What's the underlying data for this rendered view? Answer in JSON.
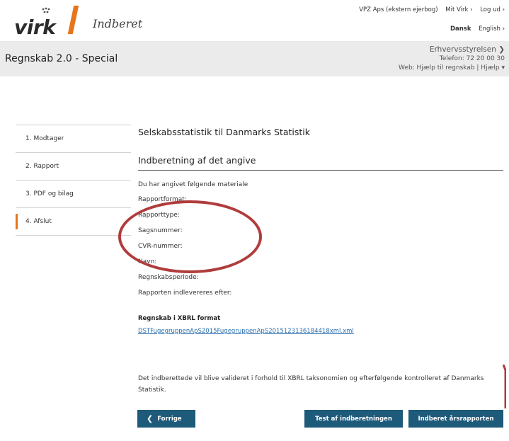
{
  "header": {
    "logo_text": "virk",
    "product": "Indberet",
    "company": "VPZ Aps (ekstern ejerbog)",
    "my_virk": "Mit Virk ›",
    "logout": "Log ud ›",
    "lang_active": "Dansk",
    "lang_other": "English ›"
  },
  "subheader": {
    "title": "Regnskab 2.0 - Special",
    "org": "Erhvervsstyrelsen ❯",
    "phone": "Telefon: 72 20 00 30",
    "web": "Web: Hjælp til regnskab | Hjælp ▾"
  },
  "sidebar": {
    "items": [
      {
        "label": "1. Modtager"
      },
      {
        "label": "2. Rapport"
      },
      {
        "label": "3. PDF og bilag"
      },
      {
        "label": "4. Afslut"
      }
    ]
  },
  "main": {
    "title": "Selskabsstatistik til Danmarks Statistik",
    "section_title": "Indberetning af det angive",
    "intro": "Du har angivet følgende materiale",
    "fields": [
      "Rapportformat:",
      "Rapporttype:",
      "Sagsnummer:",
      "CVR-nummer:",
      "Navn:",
      "Regnskabsperiode:",
      "Rapporten indlevereres efter:"
    ],
    "xbrl_title": "Regnskab i XBRL format",
    "xbrl_file": "DSTFugegruppenApS2015FugegruppenApS2015123136184418xml.xml",
    "note": "Det indberettede vil blive valideret i forhold til XBRL taksonomien og efterfølgende kontrolleret af Danmarks Statistik."
  },
  "buttons": {
    "prev": "Forrige",
    "test": "Test af indberetningen",
    "submit": "Indberet årsrapporten"
  },
  "colors": {
    "accent": "#e8751a",
    "button": "#1e5a7a",
    "annotation": "#b03c3c"
  }
}
